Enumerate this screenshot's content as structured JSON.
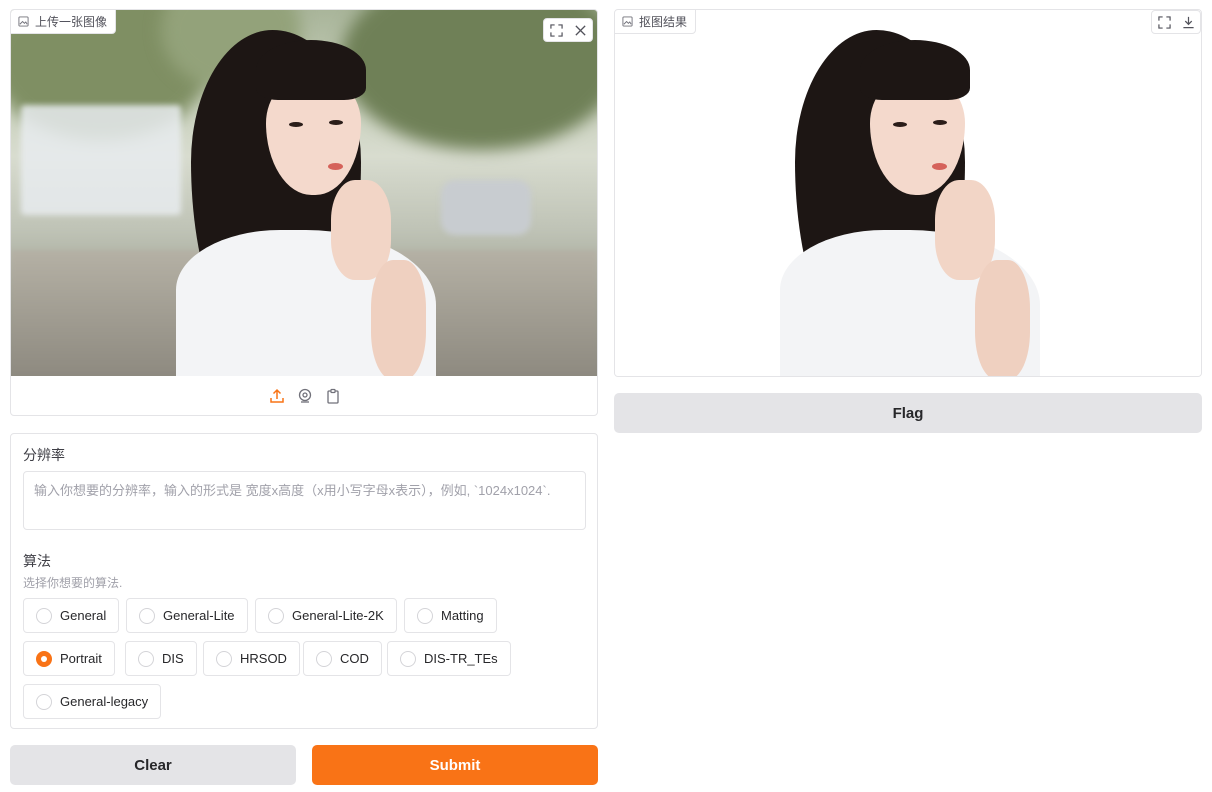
{
  "input_image": {
    "label": "上传一张图像",
    "toolbar": [
      "upload-icon",
      "webcam-icon",
      "clipboard-icon"
    ]
  },
  "output_image": {
    "label": "抠图结果"
  },
  "resolution": {
    "label": "分辨率",
    "placeholder": "输入你想要的分辨率，输入的形式是 宽度x高度（x用小写字母x表示），例如, `1024x1024`."
  },
  "algorithm": {
    "label": "算法",
    "info": "选择你想要的算法.",
    "options": [
      "General",
      "General-Lite",
      "General-Lite-2K",
      "Matting",
      "Portrait",
      "DIS",
      "HRSOD",
      "COD",
      "DIS-TR_TEs",
      "General-legacy"
    ],
    "selected": "Portrait"
  },
  "buttons": {
    "clear": "Clear",
    "submit": "Submit",
    "flag": "Flag"
  },
  "colors": {
    "accent": "#f97316",
    "secondary": "#e4e4e7"
  }
}
